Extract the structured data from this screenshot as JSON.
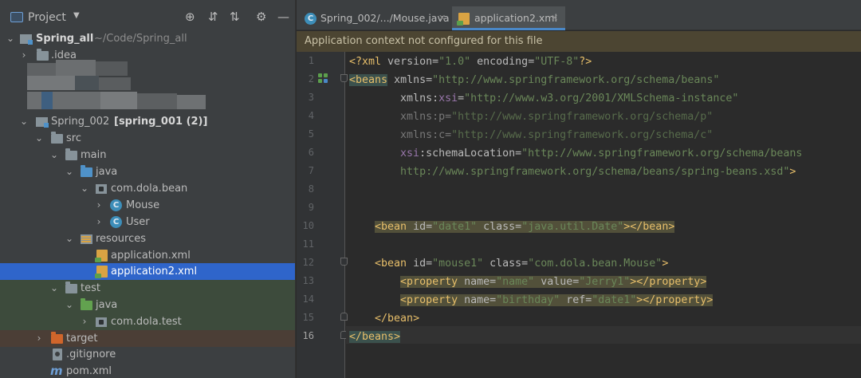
{
  "project": {
    "title": "Project",
    "tree": {
      "root": {
        "name": "Spring_all",
        "path": "~/Code/Spring_all"
      },
      "idea": ".idea",
      "module": {
        "name": "Spring_002",
        "tag": "[spring_001 (2)]"
      },
      "src": "src",
      "main": "main",
      "java": "java",
      "package": "com.dola.bean",
      "class1": "Mouse",
      "class2": "User",
      "resources": "resources",
      "file1": "application.xml",
      "file2": "application2.xml",
      "test": "test",
      "test_java": "java",
      "test_package": "com.dola.test",
      "target": "target",
      "gitignore": ".gitignore",
      "pom": "pom.xml"
    }
  },
  "tabs": [
    {
      "label": "Spring_002/.../Mouse.java",
      "active": false
    },
    {
      "label": "application2.xml",
      "active": true
    }
  ],
  "notice": "Application context not configured for this file",
  "code": {
    "current_line": 16,
    "lines": {
      "l1": {
        "num": "1"
      },
      "l2": {
        "num": "2"
      },
      "l3": {
        "num": "3"
      },
      "l4": {
        "num": "4"
      },
      "l5": {
        "num": "5"
      },
      "l6": {
        "num": "6"
      },
      "l7": {
        "num": "7"
      },
      "l8": {
        "num": "8"
      },
      "l9": {
        "num": "9"
      },
      "l10": {
        "num": "10"
      },
      "l11": {
        "num": "11"
      },
      "l12": {
        "num": "12"
      },
      "l13": {
        "num": "13"
      },
      "l14": {
        "num": "14"
      },
      "l15": {
        "num": "15"
      },
      "l16": {
        "num": "16"
      }
    },
    "text": {
      "xml_decl_open": "<?",
      "xml_decl_name": "xml",
      "version_attr": " version=",
      "version_val": "\"1.0\"",
      "encoding_attr": " encoding=",
      "encoding_val": "\"UTF-8\"",
      "xml_decl_close": "?>",
      "beans_open": "<beans",
      "xmlns_attr": "xmlns=",
      "xmlns_val": "\"http://www.springframework.org/schema/beans\"",
      "xmlns_prefix": "xmlns:",
      "xsi": "xsi",
      "eq": "=",
      "xsi_val": "\"http://www.w3.org/2001/XMLSchema-instance\"",
      "xmlns_p": "xmlns:p=",
      "xmlns_p_val": "\"http://www.springframework.org/schema/p\"",
      "xmlns_c": "xmlns:c=",
      "xmlns_c_val": "\"http://www.springframework.org/schema/c\"",
      "schema_attr": ":schemaLocation=",
      "schema_val1": "\"http://www.springframework.org/schema/beans",
      "schema_val2": "http://www.springframework.org/schema/beans/spring-beans.xsd\"",
      "gt": ">",
      "bean_open": "<bean",
      "id_attr": " id=",
      "date1_val": "\"date1\"",
      "class_attr": " class=",
      "date_class_val": "\"java.util.Date\"",
      "bean_close_inline": "></bean>",
      "mouse1_val": "\"mouse1\"",
      "mouse_class_val": "\"com.dola.bean.Mouse\"",
      "property_open": "<property",
      "name_attr": " name=",
      "name_val": "\"name\"",
      "value_attr": " value=",
      "jerry_val": "\"Jerry1\"",
      "property_close_inline": "></property>",
      "birthday_val": "\"birthday\"",
      "ref_attr": " ref=",
      "ref_val": "\"date1\"",
      "bean_close": "</bean>",
      "beans_close": "</beans>"
    }
  }
}
